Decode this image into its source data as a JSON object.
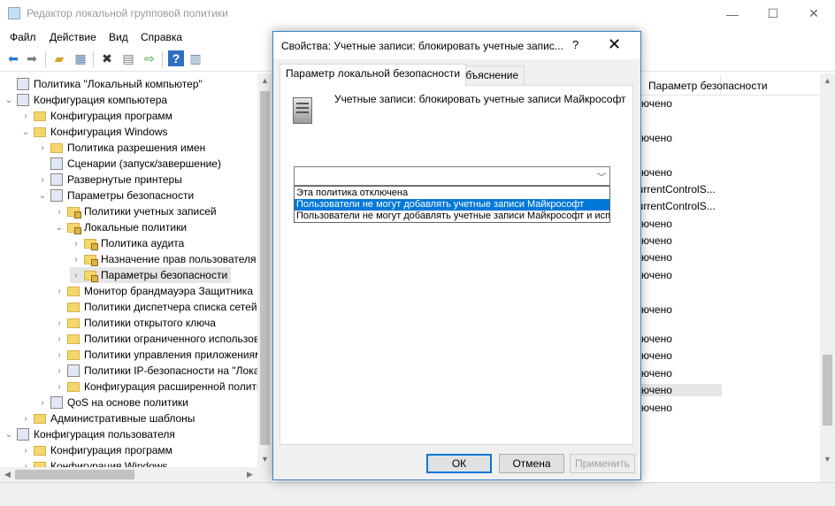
{
  "main_window": {
    "title": "Редактор локальной групповой политики",
    "controls": {
      "minimize": "—",
      "maximize": "☐",
      "close": "✕"
    }
  },
  "menu": [
    "Файл",
    "Действие",
    "Вид",
    "Справка"
  ],
  "toolbar": {
    "icons": [
      "back-arrow-icon",
      "forward-arrow-icon",
      "up-folder-icon",
      "show-hide-tree-icon",
      "delete-icon",
      "properties-icon",
      "export-list-icon",
      "help-icon",
      "extended-view-icon"
    ]
  },
  "tree": {
    "items": [
      {
        "label": "Политика \"Локальный компьютер\"",
        "level": 0,
        "expander": "",
        "icon": "computer-policy-icon"
      },
      {
        "label": "Конфигурация компьютера",
        "level": 0,
        "expander": "v",
        "icon": "computer-icon"
      },
      {
        "label": "Конфигурация программ",
        "level": 1,
        "expander": ">",
        "icon": "folder-icon"
      },
      {
        "label": "Конфигурация Windows",
        "level": 1,
        "expander": "v",
        "icon": "folder-icon"
      },
      {
        "label": "Политика разрешения имен",
        "level": 2,
        "expander": ">",
        "icon": "folder-icon"
      },
      {
        "label": "Сценарии (запуск/завершение)",
        "level": 2,
        "expander": "",
        "icon": "scripts-icon"
      },
      {
        "label": "Развернутые принтеры",
        "level": 2,
        "expander": ">",
        "icon": "printer-icon"
      },
      {
        "label": "Параметры безопасности",
        "level": 2,
        "expander": "v",
        "icon": "security-icon"
      },
      {
        "label": "Политики учетных записей",
        "level": 3,
        "expander": ">",
        "icon": "locked-folder-icon"
      },
      {
        "label": "Локальные политики",
        "level": 3,
        "expander": "v",
        "icon": "locked-folder-icon"
      },
      {
        "label": "Политика аудита",
        "level": 4,
        "expander": ">",
        "icon": "locked-folder-icon"
      },
      {
        "label": "Назначение прав пользователя",
        "level": 4,
        "expander": ">",
        "icon": "locked-folder-icon"
      },
      {
        "label": "Параметры безопасности",
        "level": 4,
        "expander": ">",
        "icon": "locked-folder-icon",
        "selected": true
      },
      {
        "label": "Монитор брандмауэра Защитника",
        "level": 3,
        "expander": ">",
        "icon": "folder-icon"
      },
      {
        "label": "Политики диспетчера списка сетей",
        "level": 3,
        "expander": "",
        "icon": "folder-icon"
      },
      {
        "label": "Политики открытого ключа",
        "level": 3,
        "expander": ">",
        "icon": "folder-icon"
      },
      {
        "label": "Политики ограниченного использования",
        "level": 3,
        "expander": ">",
        "icon": "folder-icon"
      },
      {
        "label": "Политики управления приложениями",
        "level": 3,
        "expander": ">",
        "icon": "folder-icon"
      },
      {
        "label": "Политики IP-безопасности на \"Локальный",
        "level": 3,
        "expander": ">",
        "icon": "ipsec-icon"
      },
      {
        "label": "Конфигурация расширенной политики",
        "level": 3,
        "expander": ">",
        "icon": "folder-icon"
      },
      {
        "label": "QoS на основе политики",
        "level": 2,
        "expander": ">",
        "icon": "qos-chart-icon"
      },
      {
        "label": "Административные шаблоны",
        "level": 1,
        "expander": ">",
        "icon": "folder-icon"
      },
      {
        "label": "Конфигурация пользователя",
        "level": 0,
        "expander": "v",
        "icon": "user-icon"
      },
      {
        "label": "Конфигурация программ",
        "level": 1,
        "expander": ">",
        "icon": "folder-icon"
      },
      {
        "label": "Конфигурация Windows",
        "level": 1,
        "expander": ">",
        "icon": "folder-icon"
      }
    ]
  },
  "right_pane": {
    "column_header": "Параметр безопасности",
    "values": [
      "лючено",
      "лючено",
      "лючено",
      "lurrentControlS...",
      "lurrentControlS...",
      "лючено",
      "лючено",
      "лючено",
      "лючено",
      "лючено",
      "лючено",
      "лючено",
      "лючено",
      "лючено",
      "лючено",
      "иратор"
    ]
  },
  "dialog": {
    "title": "Свойства: Учетные записи: блокировать учетные запис...",
    "help": "?",
    "close": "✕",
    "tabs": [
      "Параметр локальной безопасности",
      "Объяснение"
    ],
    "description": "Учетные записи: блокировать учетные записи Майкрософт",
    "dropdown_value": "",
    "options": [
      "Эта политика отключена",
      "Пользователи не могут добавлять учетные записи Майкрософт",
      "Пользователи не могут добавлять учетные записи Майкрософт и использовать их для входа"
    ],
    "selected_option_index": 1,
    "buttons": {
      "ok": "ОК",
      "cancel": "Отмена",
      "apply": "Применить"
    }
  }
}
